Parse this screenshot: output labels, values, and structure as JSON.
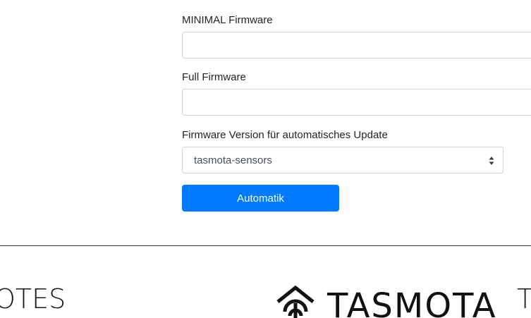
{
  "form": {
    "minimal_label": "MINIMAL Firmware",
    "minimal_value": "",
    "full_label": "Full Firmware",
    "full_value": "",
    "auto_label": "Firmware Version für automatisches Update",
    "auto_selected": "tasmota-sensors",
    "auto_button": "Automatik"
  },
  "footer": {
    "left_text": "OTES",
    "logo_text": "TASMOTA",
    "right_text": "T"
  },
  "colors": {
    "primary": "#007bff",
    "border": "#ced4da",
    "divider": "#333333"
  }
}
